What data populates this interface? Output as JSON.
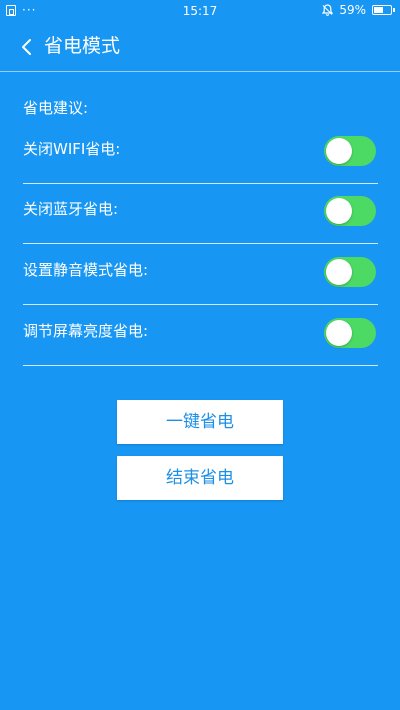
{
  "status_bar": {
    "left_dots": "···",
    "time": "15:17",
    "battery_percent": "59%",
    "battery_level": 0.59
  },
  "header": {
    "title": "省电模式"
  },
  "section": {
    "label": "省电建议:"
  },
  "options": [
    {
      "label": "关闭WIFI省电:",
      "enabled": true
    },
    {
      "label": "关闭蓝牙省电:",
      "enabled": true
    },
    {
      "label": "设置静音模式省电:",
      "enabled": true
    },
    {
      "label": "调节屏幕亮度省电:",
      "enabled": true
    }
  ],
  "buttons": {
    "one_key_label": "一键省电",
    "end_label": "结束省电"
  },
  "colors": {
    "background": "#1796f3",
    "toggle_on": "#4cd964",
    "button_text": "#1c8fe6"
  }
}
